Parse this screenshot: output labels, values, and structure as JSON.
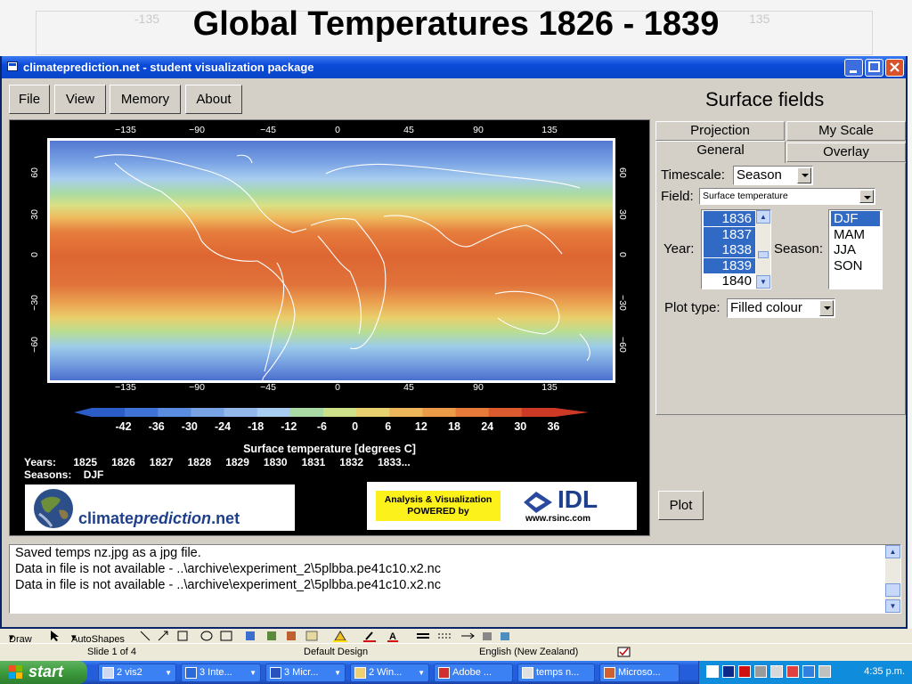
{
  "slide": {
    "title": "Global Temperatures 1826 - 1839",
    "ghost_labels": [
      "-135",
      "135"
    ]
  },
  "window": {
    "title": "climateprediction.net - student visualization package",
    "menu": [
      "File",
      "View",
      "Memory",
      "About"
    ],
    "panel_title": "Surface fields"
  },
  "plot": {
    "lon_labels": [
      "−135",
      "−90",
      "−45",
      "0",
      "45",
      "90",
      "135"
    ],
    "lat_labels": [
      "60",
      "30",
      "0",
      "−30",
      "−60"
    ],
    "colorbar_ticks": [
      "-42",
      "-36",
      "-30",
      "-24",
      "-18",
      "-12",
      "-6",
      "0",
      "6",
      "12",
      "18",
      "24",
      "30",
      "36"
    ],
    "colorbar_colors": [
      "#2b5cc8",
      "#3f73d6",
      "#5a8de0",
      "#78a4e6",
      "#92b8ec",
      "#a9cdf0",
      "#a9d9a4",
      "#cfe08a",
      "#e8d070",
      "#edb65a",
      "#eb9a48",
      "#e57a3a",
      "#db5a2e",
      "#cc3a26"
    ],
    "colorbar_title": "Surface temperature [degrees C]",
    "years_label": "Years:",
    "years": [
      "1825",
      "1826",
      "1827",
      "1828",
      "1829",
      "1830",
      "1831",
      "1832",
      "1833..."
    ],
    "seasons_label": "Seasons:",
    "seasons": "DJF",
    "logo_cpdn_a": "climate",
    "logo_cpdn_b": "prediction",
    "logo_cpdn_c": ".net",
    "idl_badge_line1": "Analysis & Visualization",
    "idl_badge_line2": "POWERED by",
    "idl_name": "IDL",
    "idl_url": "www.rsinc.com"
  },
  "controls": {
    "tabs_back": [
      "Projection",
      "My Scale"
    ],
    "tabs_front": [
      "General",
      "Overlay"
    ],
    "timescale_label": "Timescale:",
    "timescale_value": "Season",
    "field_label": "Field:",
    "field_value": "Surface temperature",
    "year_label": "Year:",
    "year_items": [
      {
        "label": "1836",
        "selected": true
      },
      {
        "label": "1837",
        "selected": true
      },
      {
        "label": "1838",
        "selected": true
      },
      {
        "label": "1839",
        "selected": true
      },
      {
        "label": "1840",
        "selected": false
      }
    ],
    "season_label": "Season:",
    "season_items": [
      {
        "label": "DJF",
        "selected": true
      },
      {
        "label": "MAM",
        "selected": false
      },
      {
        "label": "JJA",
        "selected": false
      },
      {
        "label": "SON",
        "selected": false
      }
    ],
    "plot_type_label": "Plot type:",
    "plot_type_value": "Filled colour",
    "plot_button": "Plot"
  },
  "log": [
    "Saved temps nz.jpg as a jpg file.",
    "Data in file is not available - ..\\archive\\experiment_2\\5plbba.pe41c10.x2.nc",
    "Data in file is not available - ..\\archive\\experiment_2\\5plbba.pe41c10.x2.nc"
  ],
  "drawbar": {
    "draw": "Draw",
    "autoshapes": "AutoShapes"
  },
  "status": {
    "slide": "Slide 1 of 4",
    "design": "Default Design",
    "language": "English (New Zealand)"
  },
  "taskbar": {
    "start": "start",
    "tasks": [
      "2 vis2",
      "3 Inte...",
      "3 Micr...",
      "2 Win...",
      "Adobe ...",
      "temps n...",
      "Microso..."
    ],
    "clock": "4:35 p.m."
  }
}
